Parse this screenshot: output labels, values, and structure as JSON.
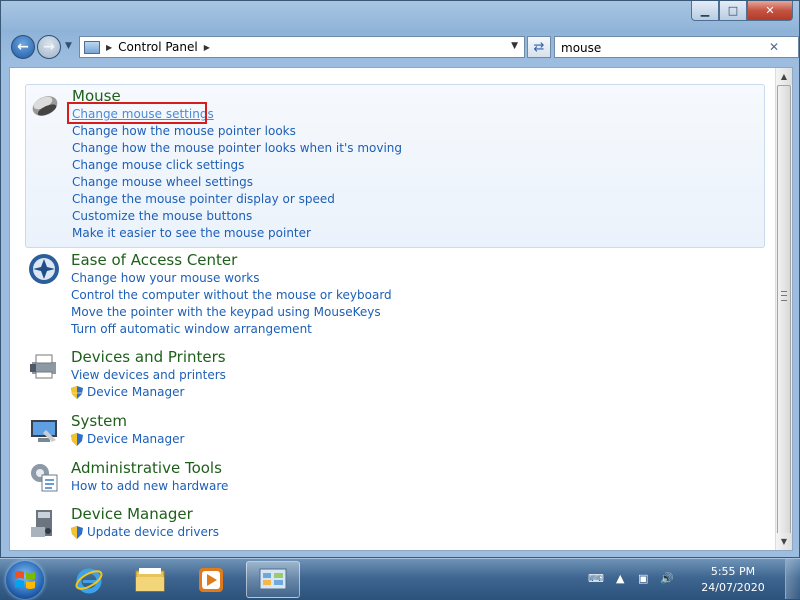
{
  "window": {
    "caption": {
      "minimize": "▁",
      "maximize": "□",
      "close": "✕"
    }
  },
  "navbar": {
    "address_path": "Control Panel",
    "search_value": "mouse"
  },
  "groups": [
    {
      "title": "Mouse",
      "links": [
        "Change mouse settings",
        "Change how the mouse pointer looks",
        "Change how the mouse pointer looks when it's moving",
        "Change mouse click settings",
        "Change mouse wheel settings",
        "Change the mouse pointer display or speed",
        "Customize the mouse buttons",
        "Make it easier to see the mouse pointer"
      ]
    },
    {
      "title": "Ease of Access Center",
      "links": [
        "Change how your mouse works",
        "Control the computer without the mouse or keyboard",
        "Move the pointer with the keypad using MouseKeys",
        "Turn off automatic window arrangement"
      ]
    },
    {
      "title": "Devices and Printers",
      "links": [
        "View devices and printers"
      ],
      "shield_links": [
        "Device Manager"
      ]
    },
    {
      "title": "System",
      "shield_links": [
        "Device Manager"
      ]
    },
    {
      "title": "Administrative Tools",
      "links": [
        "How to add new hardware"
      ]
    },
    {
      "title": "Device Manager",
      "shield_links": [
        "Update device drivers"
      ]
    }
  ],
  "taskbar": {
    "time": "5:55 PM",
    "date": "24/07/2020"
  }
}
